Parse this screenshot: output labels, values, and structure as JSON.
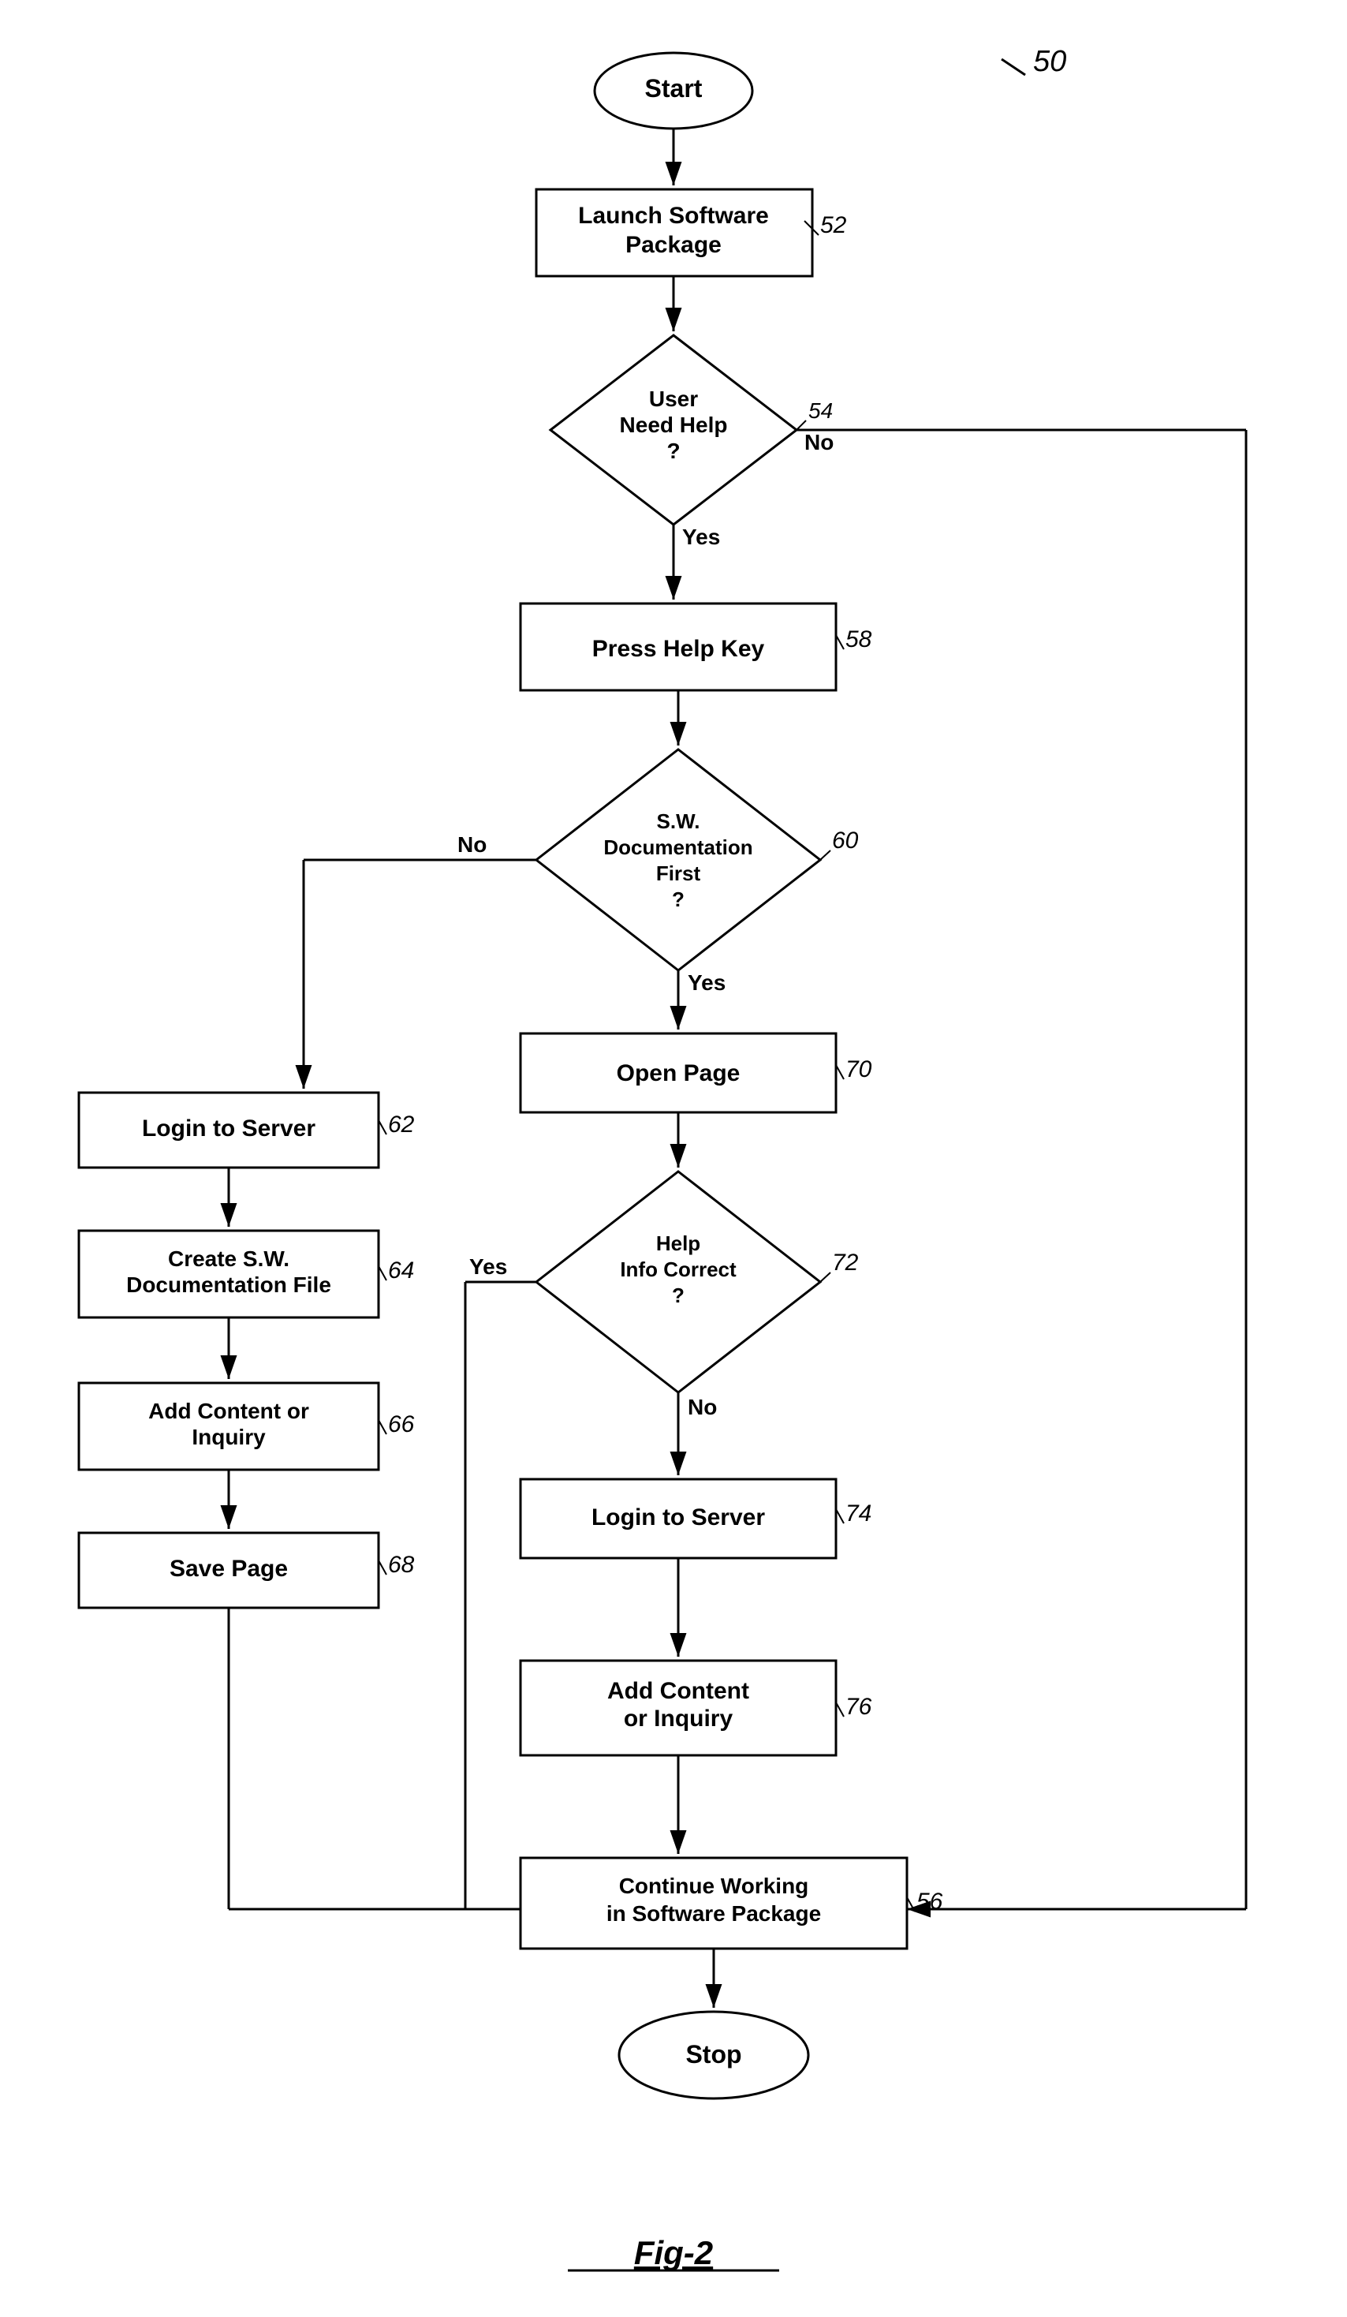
{
  "diagram": {
    "title": "Fig-2",
    "figure_number": "50",
    "nodes": {
      "start": {
        "label": "Start",
        "id": "start"
      },
      "launch": {
        "label": "Launch Software\nPackage",
        "ref": "52"
      },
      "user_need_help": {
        "label": "User\nNeed Help\n?",
        "ref": "54"
      },
      "press_help": {
        "label": "Press Help Key",
        "ref": "58"
      },
      "sw_doc_first": {
        "label": "S.W.\nDocumentation\nFirst\n?",
        "ref": "60"
      },
      "login_server_left": {
        "label": "Login to Server",
        "ref": "62"
      },
      "create_sw_doc": {
        "label": "Create S.W.\nDocumentation File",
        "ref": "64"
      },
      "add_content_left": {
        "label": "Add Content or\nInquiry",
        "ref": "66"
      },
      "save_page": {
        "label": "Save Page",
        "ref": "68"
      },
      "open_page": {
        "label": "Open Page",
        "ref": "70"
      },
      "help_info_correct": {
        "label": "Help\nInfo Correct\n?",
        "ref": "72"
      },
      "login_server_right": {
        "label": "Login to Server",
        "ref": "74"
      },
      "add_content_right": {
        "label": "Add Content\nor Inquiry",
        "ref": "76"
      },
      "continue_working": {
        "label": "Continue Working\nin Software Package",
        "ref": "56"
      },
      "stop": {
        "label": "Stop",
        "id": "stop"
      }
    },
    "labels": {
      "yes": "Yes",
      "no": "No",
      "fig": "Fig-2"
    }
  }
}
